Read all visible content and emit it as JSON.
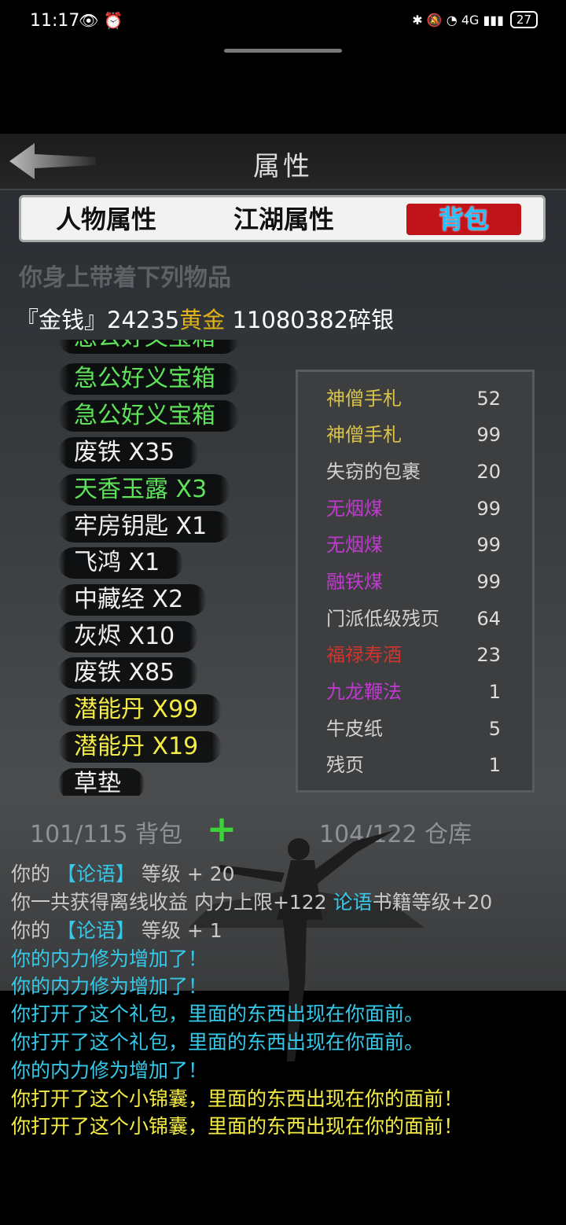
{
  "status_bar": {
    "time": "11:17",
    "left_icons": "👁 ⏰",
    "right_icons": "✱ 🔕 ◔ 4G ▮▮▮",
    "battery": "27"
  },
  "header": {
    "title": "属性",
    "back_icon": "back-arrow-icon"
  },
  "tabs": {
    "tab1": "人物属性",
    "tab2": "江湖属性",
    "tab3": "背包",
    "active": "背包"
  },
  "inventory": {
    "subtitle": "你身上带着下列物品",
    "money_prefix": "『金钱』24235",
    "money_gold_word": "黄金",
    "money_suffix": " 11080382碎银",
    "left_items": [
      {
        "label": "急公好义宝箱",
        "color": "#5ee25a"
      },
      {
        "label": "急公好义宝箱",
        "color": "#5ee25a"
      },
      {
        "label": "急公好义宝箱",
        "color": "#5ee25a"
      },
      {
        "label": "废铁 X35",
        "color": "#f0f0f0"
      },
      {
        "label": "天香玉露 X3",
        "color": "#5ee25a"
      },
      {
        "label": "牢房钥匙 X1",
        "color": "#f0f0f0"
      },
      {
        "label": "飞鸿 X1",
        "color": "#f0f0f0"
      },
      {
        "label": "中藏经 X2",
        "color": "#f0f0f0"
      },
      {
        "label": "灰烬 X10",
        "color": "#f0f0f0"
      },
      {
        "label": "废铁 X85",
        "color": "#f0f0f0"
      },
      {
        "label": "潜能丹 X99",
        "color": "#f4ec45"
      },
      {
        "label": "潜能丹 X19",
        "color": "#f4ec45"
      },
      {
        "label": "草垫",
        "color": "#f0f0f0"
      }
    ],
    "right_items": [
      {
        "name": "神僧手札",
        "count": "52",
        "color": "#d8c24a"
      },
      {
        "name": "神僧手札",
        "count": "99",
        "color": "#d8c24a"
      },
      {
        "name": "失窃的包裹",
        "count": "20",
        "color": "#d0d0d0"
      },
      {
        "name": "无烟煤",
        "count": "99",
        "color": "#c03ad0"
      },
      {
        "name": "无烟煤",
        "count": "99",
        "color": "#c03ad0"
      },
      {
        "name": "融铁煤",
        "count": "99",
        "color": "#c03ad0"
      },
      {
        "name": "门派低级残页",
        "count": "64",
        "color": "#d0d0d0"
      },
      {
        "name": "福禄寿酒",
        "count": "23",
        "color": "#d0342c"
      },
      {
        "name": "九龙鞭法",
        "count": "1",
        "color": "#c03ad0"
      },
      {
        "name": "牛皮纸",
        "count": "5",
        "color": "#d0d0d0"
      },
      {
        "name": "残页",
        "count": "1",
        "color": "#d0d0d0"
      }
    ],
    "bag_capacity": "101/115 背包",
    "plus_label": "+",
    "storage_capacity": "104/122 仓库"
  },
  "log": {
    "l1a": "你的 ",
    "l1b": "【论语】",
    "l1c": " 等级 + 20",
    "l2a": "你一共获得离线收益 内力上限+122 ",
    "l2b": "论语",
    "l2c": "书籍等级+20",
    "l3a": "你的 ",
    "l3b": "【论语】",
    "l3c": " 等级 + 1",
    "l4": "你的内力修为增加了！",
    "l5": "你的内力修为增加了！",
    "l6": "你打开了这个礼包，里面的东西出现在你面前。",
    "l7": "你打开了这个礼包，里面的东西出现在你面前。",
    "l8": "你的内力修为增加了！",
    "l9": "你打开了这个小锦囊，里面的东西出现在你的面前！",
    "l10": "你打开了这个小锦囊，里面的东西出现在你的面前！"
  }
}
